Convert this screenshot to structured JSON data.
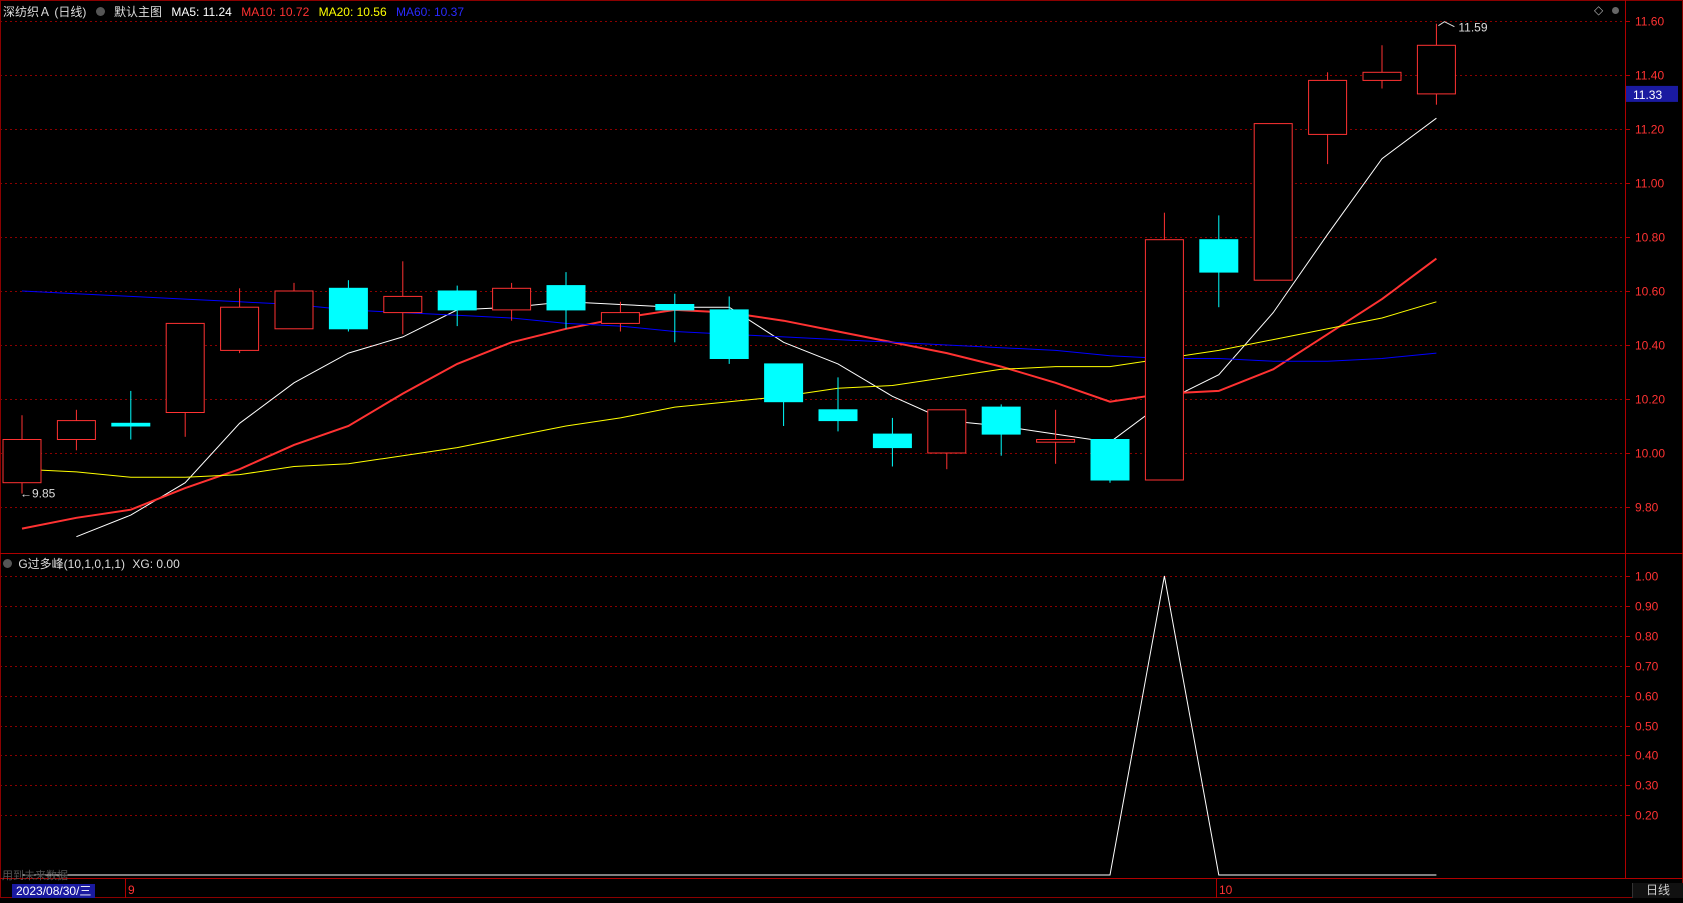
{
  "header": {
    "stock_name": "深纺织Ａ (日线)",
    "main_chart_label": "默认主图",
    "ma5_label": "MA5: 11.24",
    "ma10_label": "MA10: 10.72",
    "ma20_label": "MA20: 10.56",
    "ma60_label": "MA60: 10.37",
    "diamond_icon": "diamond-icon"
  },
  "sub_header": {
    "indicator_label": "G过多峰(10,1,0,1,1)",
    "xg_label": "XG: 0.00"
  },
  "price_tag": "11.33",
  "max_annotation": "11.59",
  "min_annotation": "←9.85",
  "footer": {
    "note": "用到未来数据",
    "date": "2023/08/30/三",
    "month_9": "9",
    "month_10": "10",
    "period": "日线"
  },
  "colors": {
    "up": "#ff3232",
    "down": "#00ffff",
    "ma5": "#ffffff",
    "ma10": "#ff3232",
    "ma20": "#ffff00",
    "ma60": "#0000ff",
    "grid": "#8b0000",
    "axis_text": "#ff3232",
    "price_tag_bg": "#1a1aa0"
  },
  "chart_data": [
    {
      "type": "candlestick",
      "yticks": [
        "11.60",
        "11.40",
        "11.20",
        "11.00",
        "10.80",
        "10.60",
        "10.40",
        "10.20",
        "10.00",
        "9.80"
      ],
      "ylim": [
        9.7,
        11.66
      ],
      "grid": true,
      "candles": [
        {
          "o": 9.89,
          "c": 10.05,
          "h": 10.14,
          "l": 9.85
        },
        {
          "o": 10.05,
          "c": 10.12,
          "h": 10.16,
          "l": 10.01
        },
        {
          "o": 10.11,
          "c": 10.1,
          "h": 10.23,
          "l": 10.05
        },
        {
          "o": 10.15,
          "c": 10.48,
          "h": 10.48,
          "l": 10.06
        },
        {
          "o": 10.38,
          "c": 10.54,
          "h": 10.61,
          "l": 10.37
        },
        {
          "o": 10.46,
          "c": 10.6,
          "h": 10.63,
          "l": 10.46
        },
        {
          "o": 10.61,
          "c": 10.46,
          "h": 10.64,
          "l": 10.45
        },
        {
          "o": 10.52,
          "c": 10.58,
          "h": 10.71,
          "l": 10.44
        },
        {
          "o": 10.6,
          "c": 10.53,
          "h": 10.62,
          "l": 10.47
        },
        {
          "o": 10.53,
          "c": 10.61,
          "h": 10.63,
          "l": 10.49
        },
        {
          "o": 10.62,
          "c": 10.53,
          "h": 10.67,
          "l": 10.46
        },
        {
          "o": 10.48,
          "c": 10.52,
          "h": 10.56,
          "l": 10.45
        },
        {
          "o": 10.55,
          "c": 10.53,
          "h": 10.59,
          "l": 10.41
        },
        {
          "o": 10.53,
          "c": 10.35,
          "h": 10.58,
          "l": 10.33
        },
        {
          "o": 10.33,
          "c": 10.19,
          "h": 10.33,
          "l": 10.1
        },
        {
          "o": 10.16,
          "c": 10.12,
          "h": 10.28,
          "l": 10.08
        },
        {
          "o": 10.07,
          "c": 10.02,
          "h": 10.13,
          "l": 9.95
        },
        {
          "o": 10.0,
          "c": 10.16,
          "h": 10.16,
          "l": 9.94
        },
        {
          "o": 10.17,
          "c": 10.07,
          "h": 10.18,
          "l": 9.99
        },
        {
          "o": 10.04,
          "c": 10.05,
          "h": 10.16,
          "l": 9.96
        },
        {
          "o": 10.05,
          "c": 9.9,
          "h": 10.05,
          "l": 9.89
        },
        {
          "o": 9.9,
          "c": 10.79,
          "h": 10.89,
          "l": 9.9
        },
        {
          "o": 10.79,
          "c": 10.67,
          "h": 10.88,
          "l": 10.54
        },
        {
          "o": 10.64,
          "c": 11.22,
          "h": 11.22,
          "l": 10.64
        },
        {
          "o": 11.18,
          "c": 11.38,
          "h": 11.41,
          "l": 11.07
        },
        {
          "o": 11.38,
          "c": 11.41,
          "h": 11.51,
          "l": 11.35
        },
        {
          "o": 11.33,
          "c": 11.51,
          "h": 11.59,
          "l": 11.29
        }
      ],
      "series": [
        {
          "name": "MA5",
          "values": [
            9.69,
            9.77,
            9.89,
            10.11,
            10.26,
            10.37,
            10.43,
            10.53,
            10.54,
            10.56,
            10.55,
            10.54,
            10.54,
            10.41,
            10.33,
            10.21,
            10.12,
            10.1,
            10.07,
            10.04,
            10.19,
            10.29,
            10.52,
            10.81,
            11.09,
            11.24
          ]
        },
        {
          "name": "MA10",
          "values": [
            9.72,
            9.76,
            9.79,
            9.87,
            9.94,
            10.03,
            10.1,
            10.22,
            10.33,
            10.41,
            10.46,
            10.5,
            10.53,
            10.52,
            10.49,
            10.45,
            10.41,
            10.37,
            10.32,
            10.26,
            10.19,
            10.22,
            10.23,
            10.31,
            10.44,
            10.57,
            10.72
          ]
        },
        {
          "name": "MA20",
          "values": [
            9.94,
            9.93,
            9.91,
            9.91,
            9.92,
            9.95,
            9.96,
            9.99,
            10.02,
            10.06,
            10.1,
            10.13,
            10.17,
            10.19,
            10.21,
            10.24,
            10.25,
            10.28,
            10.31,
            10.32,
            10.32,
            10.35,
            10.38,
            10.42,
            10.46,
            10.5,
            10.56
          ]
        },
        {
          "name": "MA60",
          "values": [
            10.6,
            10.59,
            10.58,
            10.57,
            10.56,
            10.55,
            10.53,
            10.52,
            10.51,
            10.5,
            10.48,
            10.47,
            10.45,
            10.44,
            10.43,
            10.42,
            10.41,
            10.4,
            10.39,
            10.38,
            10.36,
            10.35,
            10.35,
            10.34,
            10.34,
            10.35,
            10.37
          ]
        }
      ]
    },
    {
      "type": "line",
      "yticks": [
        "1.00",
        "0.90",
        "0.80",
        "0.70",
        "0.60",
        "0.50",
        "0.40",
        "0.30",
        "0.20"
      ],
      "ylim": [
        -0.06,
        1.03
      ],
      "grid": true,
      "series": [
        {
          "name": "XG",
          "values": [
            0,
            0,
            0,
            0,
            0,
            0,
            0,
            0,
            0,
            0,
            0,
            0,
            0,
            0,
            0,
            0,
            0,
            0,
            0,
            0,
            0,
            1,
            0,
            0,
            0,
            0,
            0
          ]
        }
      ]
    }
  ]
}
